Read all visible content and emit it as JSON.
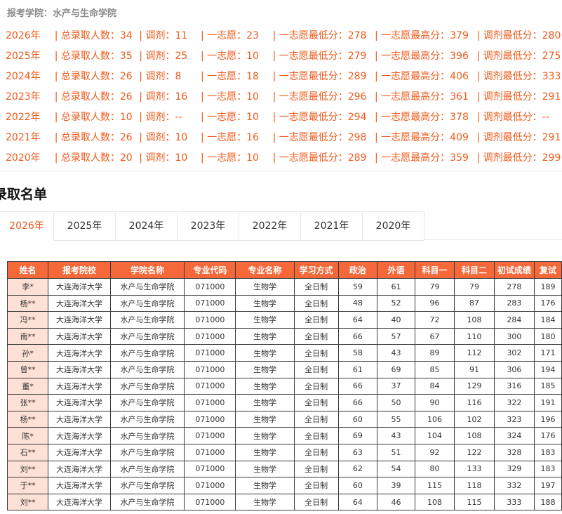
{
  "header": {
    "college_label": "报考学院：水产与生命学院"
  },
  "stats": [
    {
      "year": "2026年",
      "total": "总录取人数：34",
      "adjust": "调剂：11",
      "first": "一志愿：23",
      "first_min": "一志愿最低分：278",
      "first_max": "一志愿最高分：379",
      "adjust_min": "调剂最低分：280"
    },
    {
      "year": "2025年",
      "total": "总录取人数：35",
      "adjust": "调剂：25",
      "first": "一志愿：10",
      "first_min": "一志愿最低分：279",
      "first_max": "一志愿最高分：396",
      "adjust_min": "调剂最低分：275"
    },
    {
      "year": "2024年",
      "total": "总录取人数：26",
      "adjust": "调剂：8",
      "first": "一志愿：18",
      "first_min": "一志愿最低分：289",
      "first_max": "一志愿最高分：406",
      "adjust_min": "调剂最低分：333"
    },
    {
      "year": "2023年",
      "total": "总录取人数：26",
      "adjust": "调剂：16",
      "first": "一志愿：10",
      "first_min": "一志愿最低分：296",
      "first_max": "一志愿最高分：361",
      "adjust_min": "调剂最低分：291"
    },
    {
      "year": "2022年",
      "total": "总录取人数：10",
      "adjust": "调剂：--",
      "first": "一志愿：10",
      "first_min": "一志愿最低分：294",
      "first_max": "一志愿最高分：378",
      "adjust_min": "调剂最低分：--"
    },
    {
      "year": "2021年",
      "total": "总录取人数：26",
      "adjust": "调剂：10",
      "first": "一志愿：16",
      "first_min": "一志愿最低分：298",
      "first_max": "一志愿最高分：409",
      "adjust_min": "调剂最低分：291"
    },
    {
      "year": "2020年",
      "total": "总录取人数：20",
      "adjust": "调剂：10",
      "first": "一志愿：10",
      "first_min": "一志愿最低分：289",
      "first_max": "一志愿最高分：359",
      "adjust_min": "调剂最低分：299"
    }
  ],
  "separator": "|",
  "list_title": "录取名单",
  "tabs": [
    "2026年",
    "2025年",
    "2024年",
    "2023年",
    "2022年",
    "2021年",
    "2020年"
  ],
  "active_tab": 0,
  "table": {
    "headers": [
      "姓名",
      "报考院校",
      "学院名称",
      "专业代码",
      "专业名称",
      "学习方式",
      "政治",
      "外语",
      "科目一",
      "科目二",
      "初试成绩",
      "复试"
    ],
    "rows": [
      [
        "李*",
        "大连海洋大学",
        "水产与生命学院",
        "071000",
        "生物学",
        "全日制",
        "59",
        "61",
        "79",
        "79",
        "278",
        "189"
      ],
      [
        "杨**",
        "大连海洋大学",
        "水产与生命学院",
        "071000",
        "生物学",
        "全日制",
        "48",
        "52",
        "96",
        "87",
        "283",
        "176"
      ],
      [
        "冯**",
        "大连海洋大学",
        "水产与生命学院",
        "071000",
        "生物学",
        "全日制",
        "64",
        "40",
        "72",
        "108",
        "284",
        "184"
      ],
      [
        "南**",
        "大连海洋大学",
        "水产与生命学院",
        "071000",
        "生物学",
        "全日制",
        "66",
        "57",
        "67",
        "110",
        "300",
        "180"
      ],
      [
        "孙*",
        "大连海洋大学",
        "水产与生命学院",
        "071000",
        "生物学",
        "全日制",
        "58",
        "43",
        "89",
        "112",
        "302",
        "171"
      ],
      [
        "曾**",
        "大连海洋大学",
        "水产与生命学院",
        "071000",
        "生物学",
        "全日制",
        "61",
        "69",
        "85",
        "91",
        "306",
        "194"
      ],
      [
        "董*",
        "大连海洋大学",
        "水产与生命学院",
        "071000",
        "生物学",
        "全日制",
        "66",
        "37",
        "84",
        "129",
        "316",
        "185"
      ],
      [
        "张**",
        "大连海洋大学",
        "水产与生命学院",
        "071000",
        "生物学",
        "全日制",
        "66",
        "50",
        "90",
        "116",
        "322",
        "191"
      ],
      [
        "杨**",
        "大连海洋大学",
        "水产与生命学院",
        "071000",
        "生物学",
        "全日制",
        "60",
        "55",
        "106",
        "102",
        "323",
        "196"
      ],
      [
        "陈*",
        "大连海洋大学",
        "水产与生命学院",
        "071000",
        "生物学",
        "全日制",
        "69",
        "43",
        "104",
        "108",
        "324",
        "176"
      ],
      [
        "石**",
        "大连海洋大学",
        "水产与生命学院",
        "071000",
        "生物学",
        "全日制",
        "63",
        "51",
        "92",
        "122",
        "328",
        "183"
      ],
      [
        "刘**",
        "大连海洋大学",
        "水产与生命学院",
        "071000",
        "生物学",
        "全日制",
        "62",
        "54",
        "80",
        "133",
        "329",
        "183"
      ],
      [
        "于**",
        "大连海洋大学",
        "水产与生命学院",
        "071000",
        "生物学",
        "全日制",
        "60",
        "39",
        "115",
        "118",
        "332",
        "197"
      ],
      [
        "刘**",
        "大连海洋大学",
        "水产与生命学院",
        "071000",
        "生物学",
        "全日制",
        "64",
        "46",
        "108",
        "115",
        "333",
        "188"
      ]
    ]
  },
  "colors": {
    "accent": "#ef5b1c",
    "header_bg": "#f4683a",
    "name_bg": "#fde0d6"
  }
}
